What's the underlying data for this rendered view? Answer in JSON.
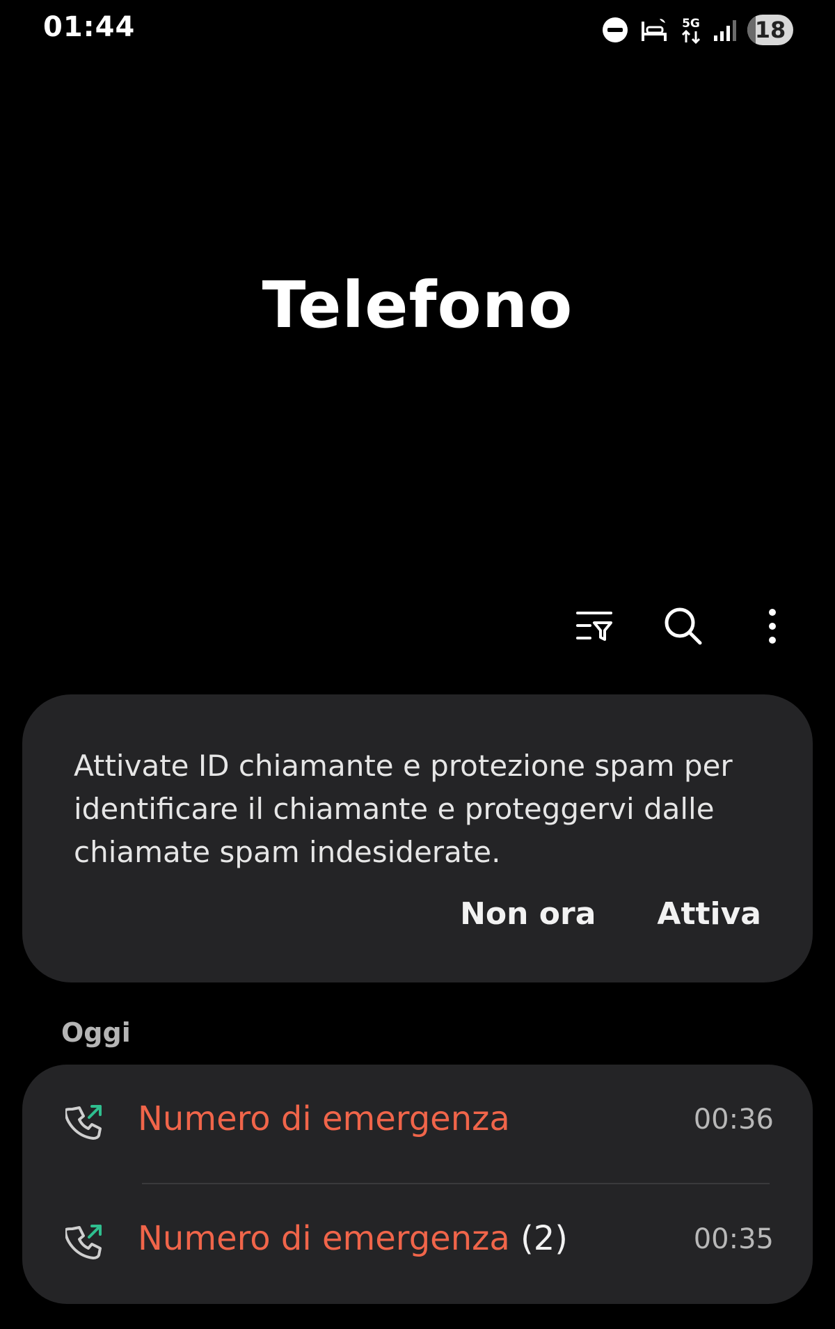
{
  "status_bar": {
    "time": "01:44",
    "network": "5G",
    "battery": "18",
    "icons": [
      "do-not-disturb-icon",
      "sleep-mode-icon",
      "5g-data-icon",
      "signal-icon",
      "battery-icon"
    ]
  },
  "app": {
    "title": "Telefono"
  },
  "toolbar": {
    "icons": [
      "filter-icon",
      "search-icon",
      "more-options-icon"
    ]
  },
  "spam_card": {
    "message": "Attivate ID chiamante e protezione spam per identificare il chiamante e proteggervi dalle chiamate spam indesiderate.",
    "dismiss_label": "Non ora",
    "enable_label": "Attiva"
  },
  "call_log": {
    "section_label": "Oggi",
    "entries": [
      {
        "name": "Numero di emergenza",
        "count": "",
        "time": "00:36",
        "icon": "outgoing-call-icon"
      },
      {
        "name": "Numero di emergenza",
        "count": "(2)",
        "time": "00:35",
        "icon": "outgoing-call-icon"
      }
    ]
  },
  "colors": {
    "background": "#000000",
    "card": "#242426",
    "emergency_name": "#f0654a",
    "call_icon_arrow": "#2fbf8f"
  }
}
